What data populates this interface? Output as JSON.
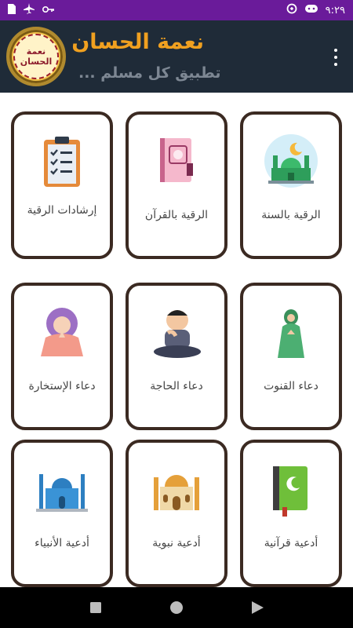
{
  "status": {
    "time": "٩:٢٩"
  },
  "header": {
    "logo_text": "نعمة الحسان",
    "title": "نعمة الحسان",
    "subtitle": "تطبيق كل مسلم ..."
  },
  "cards": [
    {
      "label": "الرقية بالسنة",
      "icon": "mosque-crescent-icon"
    },
    {
      "label": "الرقية بالقرآن",
      "icon": "quran-book-icon"
    },
    {
      "label": "إرشادات الرقية",
      "icon": "clipboard-checklist-icon"
    },
    {
      "label": "دعاء القنوت",
      "icon": "praying-woman-icon"
    },
    {
      "label": "دعاء الحاجة",
      "icon": "praying-boy-icon"
    },
    {
      "label": "دعاء الإستخارة",
      "icon": "praying-girl-icon"
    },
    {
      "label": "أدعية قرآنية",
      "icon": "green-quran-icon"
    },
    {
      "label": "أدعية نبوية",
      "icon": "golden-mosque-icon"
    },
    {
      "label": "أدعية الأنبياء",
      "icon": "blue-mosque-icon"
    }
  ],
  "colors": {
    "statusbar": "#6a1b9a",
    "appbar": "#1f2b38",
    "title": "#f0a020",
    "card_border": "#3b2a22"
  }
}
